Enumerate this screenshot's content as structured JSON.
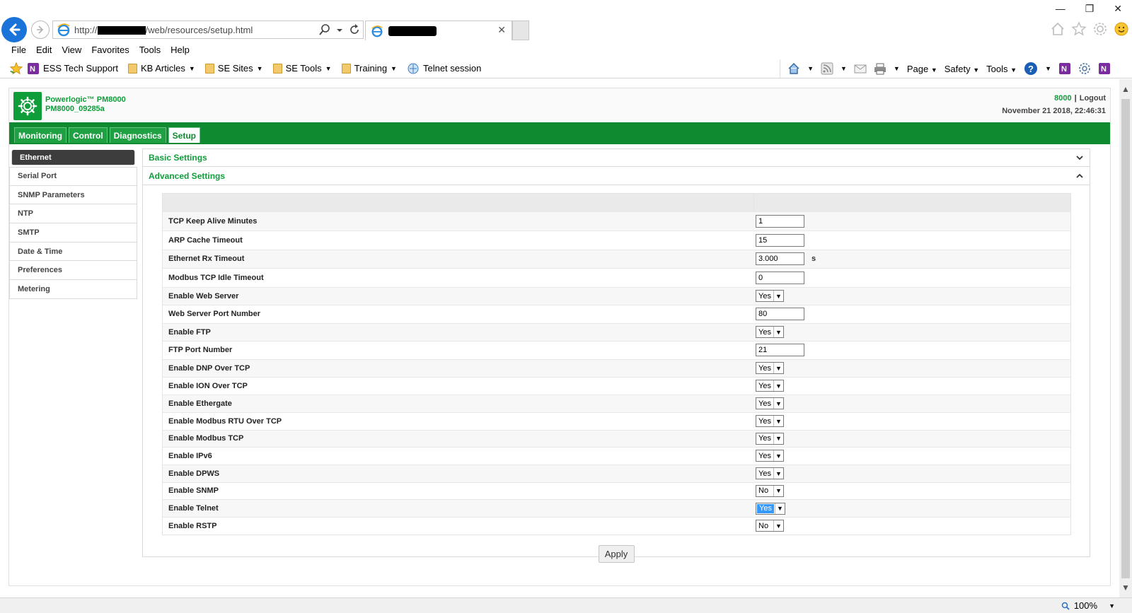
{
  "browser": {
    "url_prefix": "http://",
    "url_suffix": "/web/resources/setup.html",
    "menu": [
      "File",
      "Edit",
      "View",
      "Favorites",
      "Tools",
      "Help"
    ],
    "favorites": [
      {
        "label": "ESS Tech Support",
        "icon": "onenote-icon"
      },
      {
        "label": "KB Articles",
        "icon": "folder-icon",
        "dropdown": true
      },
      {
        "label": "SE Sites",
        "icon": "folder-icon",
        "dropdown": true
      },
      {
        "label": "SE Tools",
        "icon": "folder-icon",
        "dropdown": true
      },
      {
        "label": "Training",
        "icon": "folder-icon",
        "dropdown": true
      },
      {
        "label": "Telnet session",
        "icon": "telnet-icon"
      }
    ],
    "command_bar": {
      "page": "Page",
      "safety": "Safety",
      "tools": "Tools"
    },
    "zoom": "100%"
  },
  "header": {
    "product": "Powerlogic™ PM8000",
    "device": "PM8000_09285a",
    "user": "8000",
    "logout": "Logout",
    "datetime": "November 21 2018, 22:46:31"
  },
  "nav": {
    "tabs": [
      "Monitoring",
      "Control",
      "Diagnostics",
      "Setup"
    ],
    "active": "Setup"
  },
  "sidebar": {
    "items": [
      "Ethernet",
      "Serial Port",
      "SNMP Parameters",
      "NTP",
      "SMTP",
      "Date & Time",
      "Preferences",
      "Metering"
    ]
  },
  "main": {
    "basic_settings": "Basic Settings",
    "advanced_settings": "Advanced Settings",
    "rows": [
      {
        "label": "TCP Keep Alive Minutes",
        "type": "text",
        "value": "1"
      },
      {
        "label": "ARP Cache Timeout",
        "type": "text",
        "value": "15"
      },
      {
        "label": "Ethernet Rx Timeout",
        "type": "text",
        "value": "3.000",
        "unit": "s"
      },
      {
        "label": "Modbus TCP Idle Timeout",
        "type": "text",
        "value": "0"
      },
      {
        "label": "Enable Web Server",
        "type": "select",
        "value": "Yes"
      },
      {
        "label": "Web Server Port Number",
        "type": "text",
        "value": "80"
      },
      {
        "label": "Enable FTP",
        "type": "select",
        "value": "Yes"
      },
      {
        "label": "FTP Port Number",
        "type": "text",
        "value": "21"
      },
      {
        "label": "Enable DNP Over TCP",
        "type": "select",
        "value": "Yes"
      },
      {
        "label": "Enable ION Over TCP",
        "type": "select",
        "value": "Yes"
      },
      {
        "label": "Enable Ethergate",
        "type": "select",
        "value": "Yes"
      },
      {
        "label": "Enable Modbus RTU Over TCP",
        "type": "select",
        "value": "Yes"
      },
      {
        "label": "Enable Modbus TCP",
        "type": "select",
        "value": "Yes"
      },
      {
        "label": "Enable IPv6",
        "type": "select",
        "value": "Yes"
      },
      {
        "label": "Enable DPWS",
        "type": "select",
        "value": "Yes"
      },
      {
        "label": "Enable SNMP",
        "type": "select",
        "value": "No"
      },
      {
        "label": "Enable Telnet",
        "type": "select",
        "value": "Yes",
        "focused": true
      },
      {
        "label": "Enable RSTP",
        "type": "select",
        "value": "No"
      }
    ],
    "apply": "Apply"
  },
  "colors": {
    "brand_green": "#0f9d3a",
    "nav_green": "#0f8a30",
    "selection_blue": "#3399ff"
  }
}
